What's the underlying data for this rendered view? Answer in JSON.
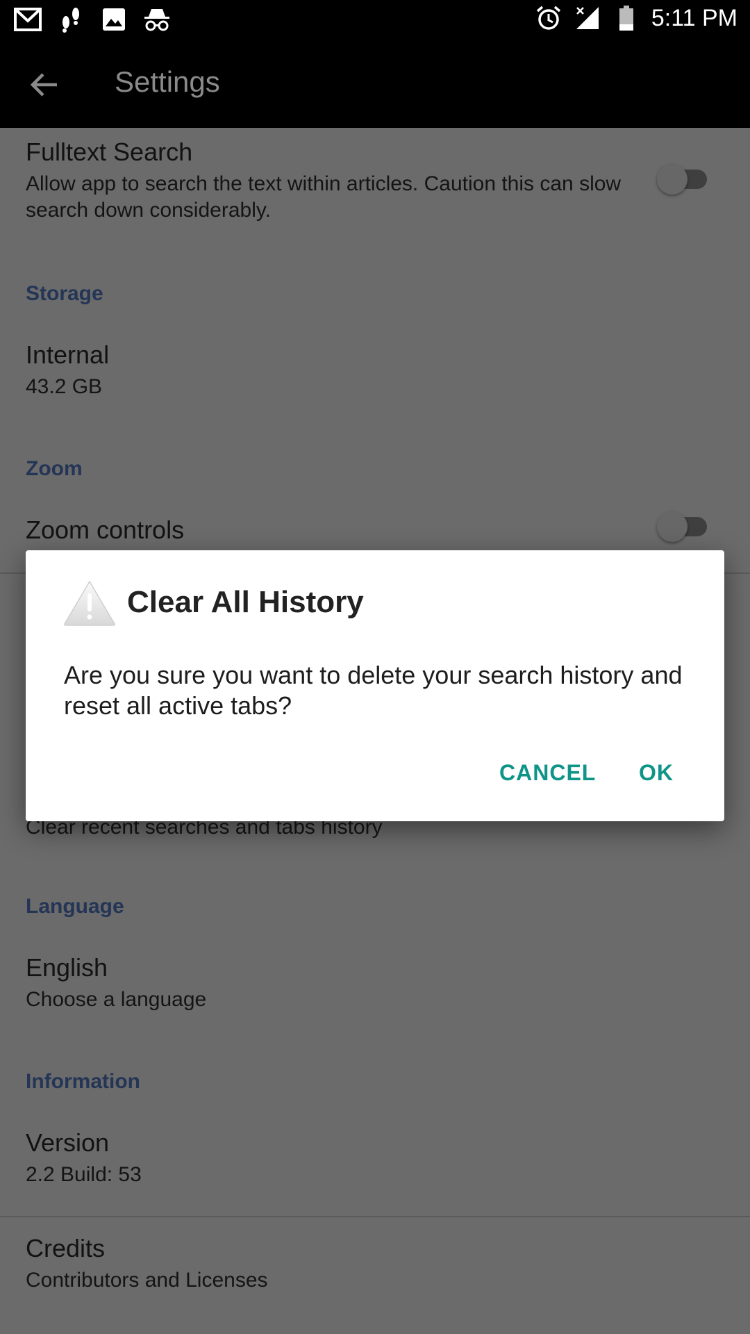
{
  "status_bar": {
    "time": "5:11 PM",
    "left_icons": [
      "gmail-icon",
      "footsteps-icon",
      "image-icon",
      "incognito-icon"
    ],
    "right_icons": [
      "alarm-icon",
      "signal-icon",
      "battery-icon"
    ]
  },
  "toolbar": {
    "title": "Settings",
    "back_icon": "back-arrow-icon"
  },
  "settings": {
    "fulltext": {
      "title": "Fulltext Search",
      "summary": "Allow app to search the text within articles. Caution this can slow search down considerably."
    },
    "storage": {
      "header": "Storage",
      "title": "Internal",
      "summary": "43.2 GB"
    },
    "zoom": {
      "header": "Zoom",
      "title": "Zoom controls"
    },
    "history": {
      "summary": "Clear recent searches and tabs history"
    },
    "language": {
      "header": "Language",
      "title": "English",
      "summary": "Choose a language"
    },
    "information": {
      "header": "Information",
      "title": "Version",
      "summary": "2.2 Build: 53"
    },
    "credits": {
      "title": "Credits",
      "summary": "Contributors and Licenses"
    }
  },
  "dialog": {
    "icon": "warning-icon",
    "title": "Clear All History",
    "message": "Are you sure you want to delete your search history and reset all active tabs?",
    "cancel_label": "CANCEL",
    "ok_label": "OK"
  },
  "colors": {
    "accent": "#0f9488",
    "section_header": "#243556",
    "scrim_background": "#6b6b6b"
  }
}
